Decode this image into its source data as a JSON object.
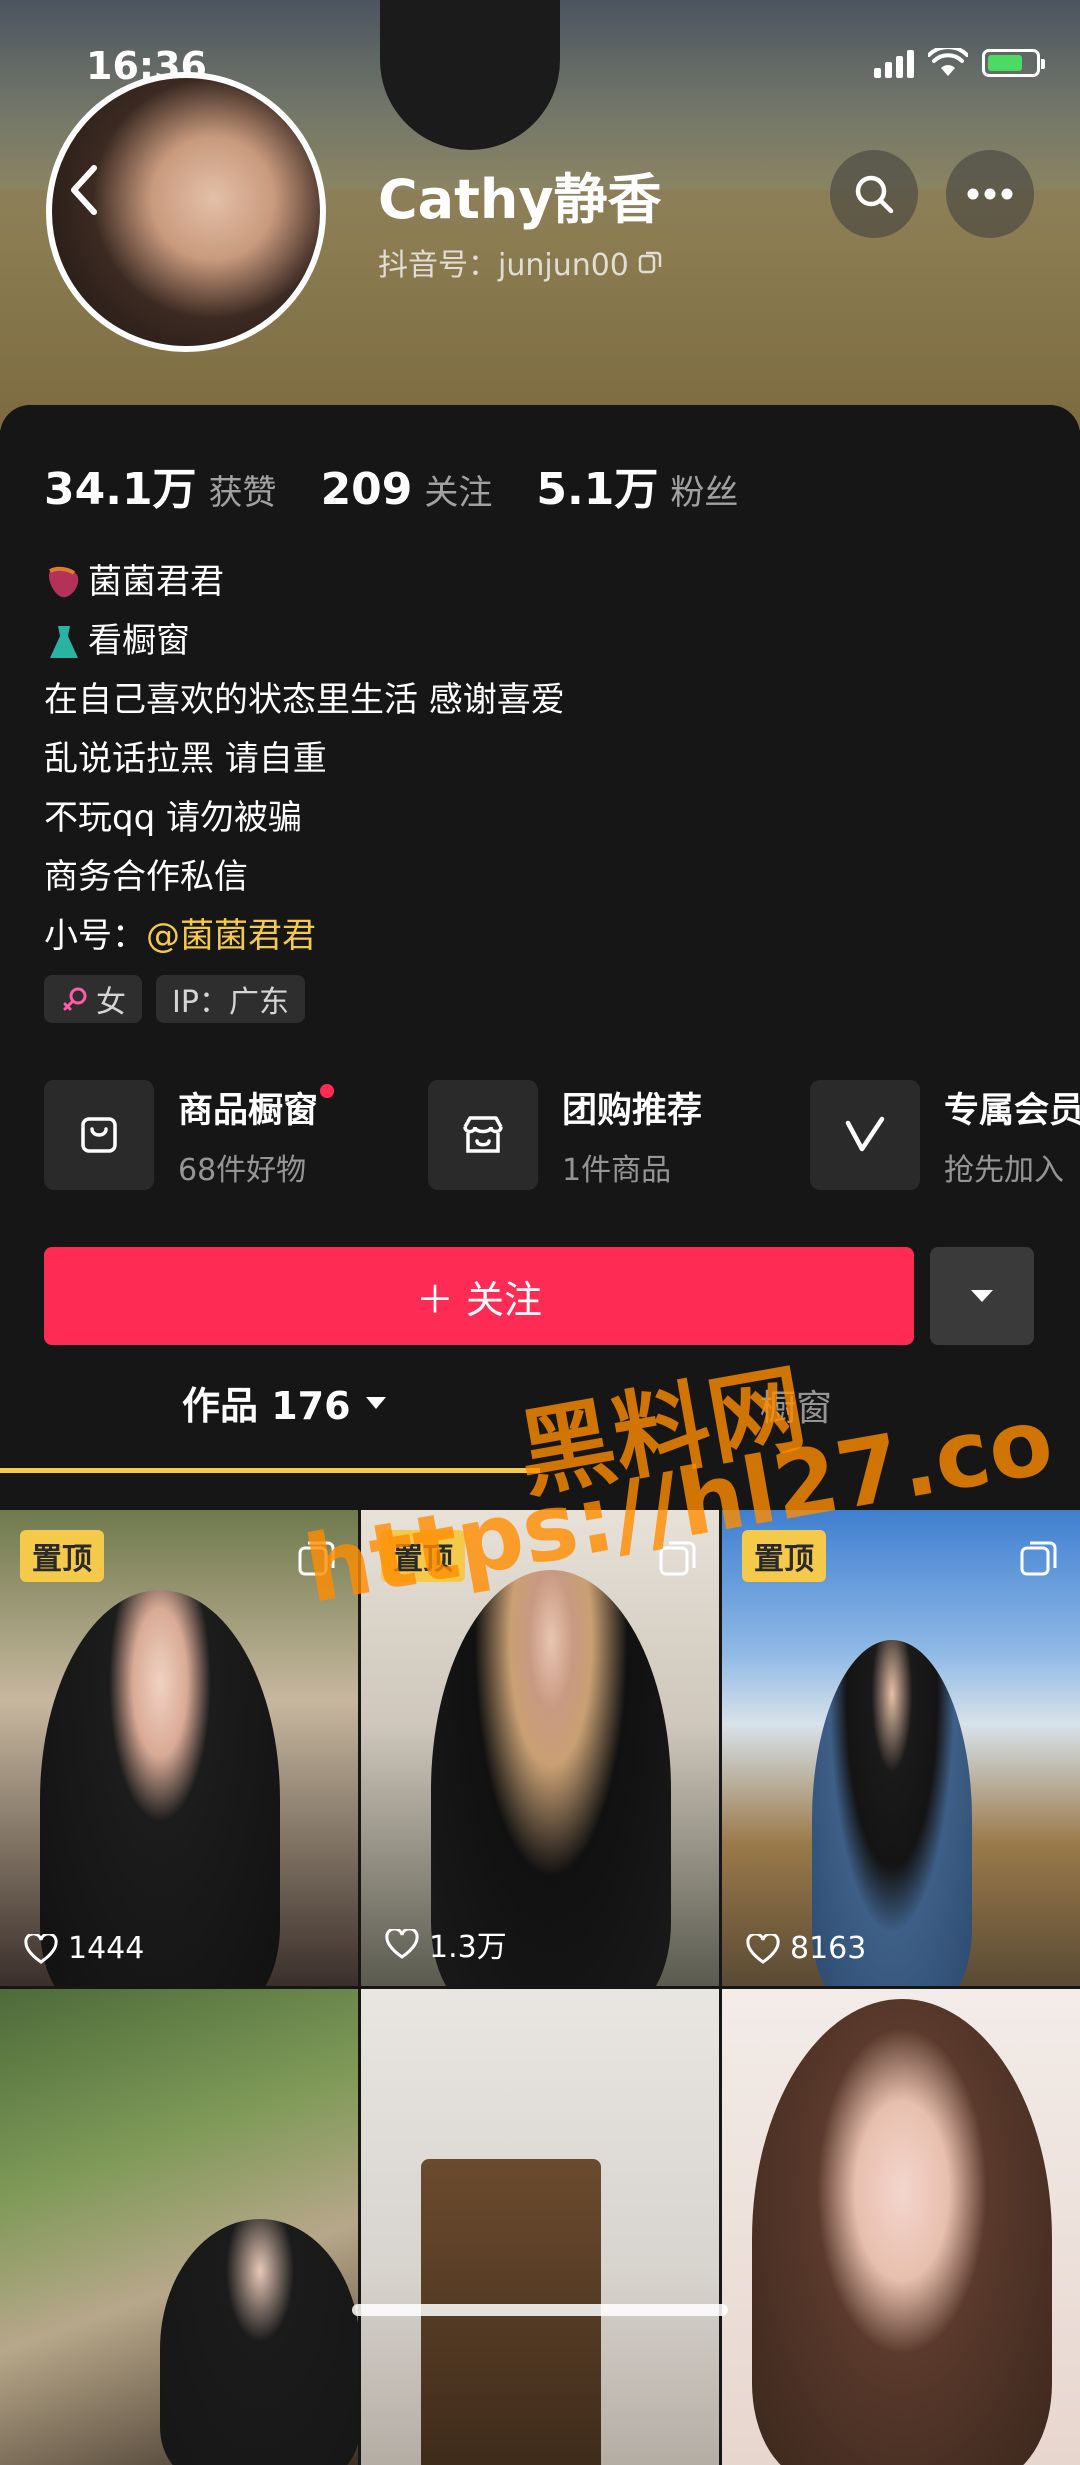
{
  "status_bar": {
    "time": "16:36",
    "icons": [
      "signal-icon",
      "wifi-icon",
      "battery-charging-icon"
    ]
  },
  "profile": {
    "name": "Cathy静香",
    "douyin_id": "抖音号：junjun00",
    "icons": [
      "back-icon",
      "search-icon",
      "more-icon",
      "copy-icon"
    ]
  },
  "stats": [
    {
      "value": "34.1万",
      "label": "获赞"
    },
    {
      "value": "209",
      "label": "关注"
    },
    {
      "value": "5.1万",
      "label": "粉丝"
    }
  ],
  "bio": {
    "line1": "菌菌君君",
    "line2": "看橱窗",
    "line3": "在自己喜欢的状态里生活 感谢喜爱",
    "line4": "乱说话拉黑 请自重",
    "line5": "不玩qq 请勿被骗",
    "line6": "商务合作私信",
    "alt_prefix": "小号：",
    "alt_mention": "@菌菌君君"
  },
  "tags": {
    "gender": "女",
    "ip": "IP：广东"
  },
  "features": [
    {
      "title": "商品橱窗",
      "sub": "68件好物",
      "icon": "bag-icon",
      "badge": true
    },
    {
      "title": "团购推荐",
      "sub": "1件商品",
      "icon": "store-icon",
      "badge": false
    },
    {
      "title": "专属会员",
      "sub": "抢先加入",
      "icon": "v-icon",
      "badge": false
    }
  ],
  "actions": {
    "follow_label": "＋ 关注"
  },
  "tabs": {
    "works": "作品 176",
    "window": "橱窗"
  },
  "grid": [
    {
      "pinned": true,
      "pin_label": "置顶",
      "likes": "1444"
    },
    {
      "pinned": true,
      "pin_label": "置顶",
      "likes": "1.3万"
    },
    {
      "pinned": true,
      "pin_label": "置顶",
      "likes": "8163"
    },
    {
      "pinned": false,
      "likes": ""
    },
    {
      "pinned": false,
      "likes": ""
    },
    {
      "pinned": false,
      "likes": ""
    }
  ],
  "watermark": {
    "line1": "黑料网",
    "line2": "https://hl27.co"
  },
  "colors": {
    "accent": "#fe2c55",
    "highlight": "#f5c94a",
    "background": "#161616"
  }
}
